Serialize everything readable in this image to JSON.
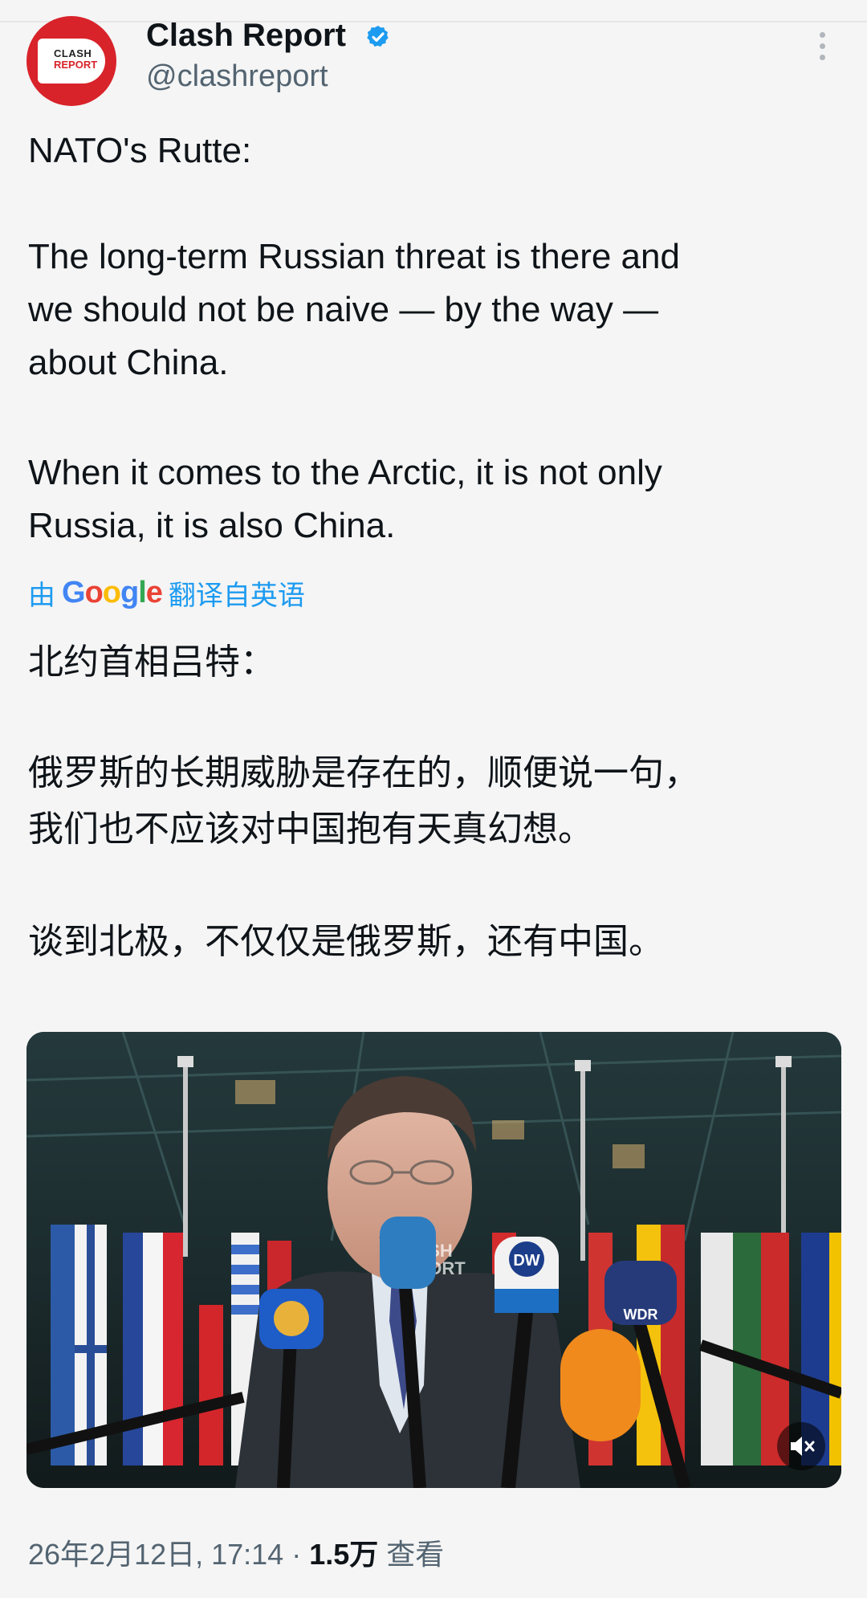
{
  "account": {
    "display_name": "Clash Report",
    "handle": "@clashreport",
    "avatar_text_1": "CLASH",
    "avatar_text_2": "REPORT",
    "verified": true,
    "verified_color": "#1d9bf0"
  },
  "tweet": {
    "original": {
      "p1": "NATO's Rutte:",
      "p2": "The long-term Russian threat is there and\nwe should not be naive — by the way —\nabout China.",
      "p3": "When it comes to the Arctic, it is not only\nRussia, it is also China."
    },
    "translation_prefix": "由",
    "translation_brand": "Google",
    "translation_suffix": "翻译自英语",
    "translated": {
      "p1": "北约首相吕特：",
      "p2": "俄罗斯的长期威胁是存在的，顺便说一句，\n我们也不应该对中国抱有天真幻想。",
      "p3": "谈到北极，不仅仅是俄罗斯，还有中国。"
    }
  },
  "media": {
    "watermark_1": "CLASH",
    "watermark_2": "REPORT",
    "mic_labels": [
      "DW",
      "WDR"
    ],
    "mute_icon": "volume-mute-icon"
  },
  "meta": {
    "date": "26年2月12日, 17:14",
    "separator": "·",
    "views_count": "1.5万",
    "views_label": "查看"
  },
  "colors": {
    "accent": "#1d9bf0",
    "brand_red": "#d8232a",
    "muted_text": "#536471"
  }
}
